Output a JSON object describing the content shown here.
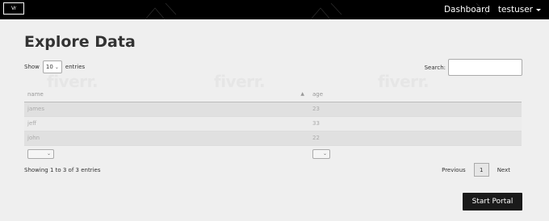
{
  "navbar": {
    "logo_text": "Vr",
    "dashboard_label": "Dashboard",
    "user_label": "testuser"
  },
  "page": {
    "title": "Explore Data"
  },
  "length": {
    "show_label": "Show",
    "value": "10",
    "entries_label": "entries"
  },
  "search": {
    "label": "Search:",
    "value": ""
  },
  "watermark": "fiverr.",
  "table": {
    "columns": [
      "name",
      "age"
    ],
    "rows": [
      [
        "james",
        "23"
      ],
      [
        "jeff",
        "33"
      ],
      [
        "john",
        "22"
      ]
    ]
  },
  "info": "Showing 1 to 3 of 3 entries",
  "pagination": {
    "previous": "Previous",
    "current": "1",
    "next": "Next"
  },
  "start_button": "Start Portal",
  "colors": {
    "navbar": "#000000",
    "background": "#efefef",
    "button": "#1a1a1a"
  }
}
